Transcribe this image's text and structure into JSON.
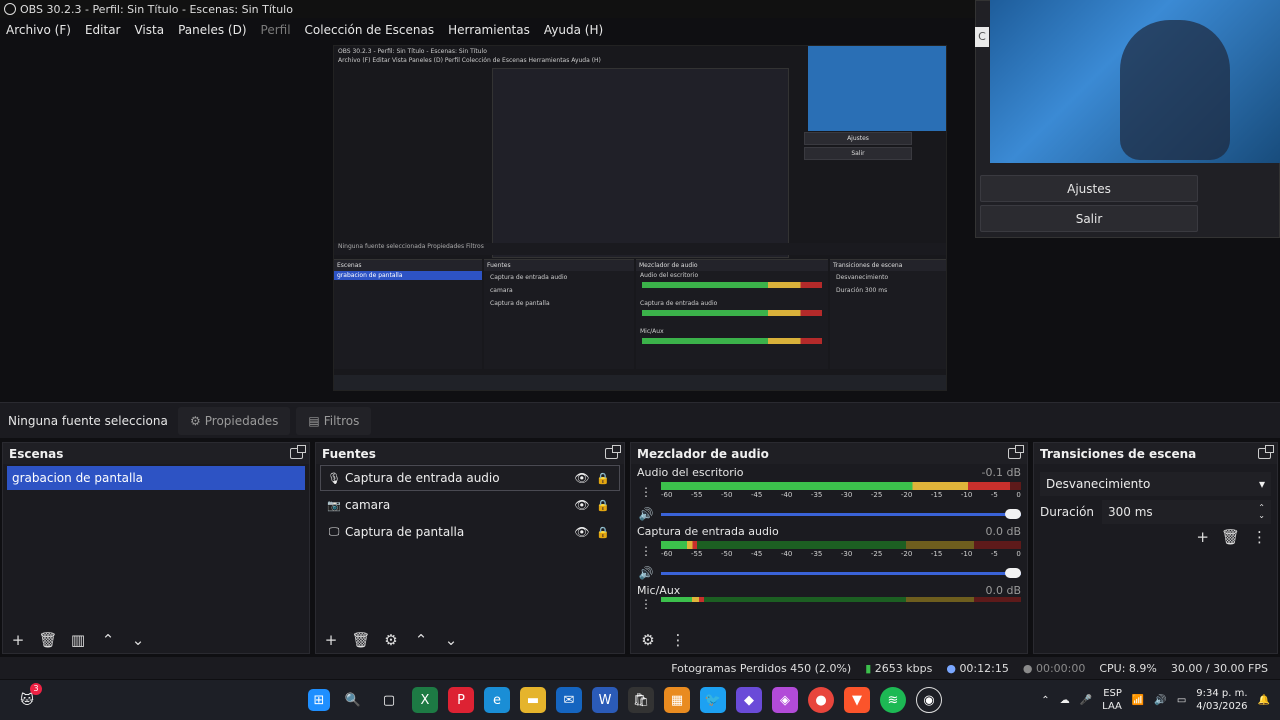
{
  "window": {
    "title": "OBS 30.2.3 - Perfil: Sin Título - Escenas: Sin Título"
  },
  "menu": [
    {
      "label": "Archivo (F)",
      "disabled": false
    },
    {
      "label": "Editar",
      "disabled": false
    },
    {
      "label": "Vista",
      "disabled": false
    },
    {
      "label": "Paneles (D)",
      "disabled": false
    },
    {
      "label": "Perfil",
      "disabled": true
    },
    {
      "label": "Colección de Escenas",
      "disabled": false
    },
    {
      "label": "Herramientas",
      "disabled": false
    },
    {
      "label": "Ayuda (H)",
      "disabled": false
    }
  ],
  "camera_window": {
    "c_label": "C",
    "buttons": [
      "Ajustes",
      "Salir"
    ]
  },
  "nested_preview": {
    "title": "OBS 30.2.3 - Perfil: Sin Título - Escenas: Sin Título",
    "menu": "Archivo (F)   Editar   Vista   Paneles (D)   Perfil   Colección de Escenas   Herramientas   Ayuda (H)",
    "strip": "Ninguna fuente seleccionada      Propiedades      Filtros",
    "scenes_head": "Escenas",
    "scene_sel": "grabacion de pantalla",
    "sources_head": "Fuentes",
    "sources": [
      "Captura de entrada audio",
      "camara",
      "Captura de pantalla"
    ],
    "mixer_head": "Mezclador de audio",
    "mixer_rows": [
      "Audio del escritorio",
      "Captura de entrada audio",
      "Mic/Aux"
    ],
    "trans_head": "Transiciones de escena",
    "trans_sel": "Desvanecimiento",
    "trans_dur": "Duración     300 ms",
    "buttons": [
      "Ajustes",
      "Salir"
    ]
  },
  "source_bar": {
    "no_source": "Ninguna fuente selecciona",
    "properties": "Propiedades",
    "filters": "Filtros"
  },
  "scenes": {
    "title": "Escenas",
    "items": [
      "grabacion de pantalla"
    ]
  },
  "sources": {
    "title": "Fuentes",
    "items": [
      {
        "name": "Captura de entrada audio",
        "icon": "mic-icon",
        "glyph": "🎙"
      },
      {
        "name": "camara",
        "icon": "camera-icon",
        "glyph": "📷"
      },
      {
        "name": "Captura de pantalla",
        "icon": "monitor-icon",
        "glyph": "🖵"
      }
    ]
  },
  "mixer": {
    "title": "Mezclador de audio",
    "scale": [
      "-60",
      "-55",
      "-50",
      "-45",
      "-40",
      "-35",
      "-30",
      "-25",
      "-20",
      "-15",
      "-10",
      "-5",
      "0"
    ],
    "channels": [
      {
        "name": "Audio del escritorio",
        "db": "-0.1 dB",
        "level": 0.97
      },
      {
        "name": "Captura de entrada audio",
        "db": "0.0 dB",
        "level": 0.1
      },
      {
        "name": "Mic/Aux",
        "db": "0.0 dB",
        "level": 0.12
      }
    ]
  },
  "transitions": {
    "title": "Transiciones de escena",
    "selected": "Desvanecimiento",
    "duration_label": "Duración",
    "duration_value": "300 ms"
  },
  "status": {
    "dropped": "Fotogramas Perdidos 450 (2.0%)",
    "kbps": "2653 kbps",
    "rec_time": "00:12:15",
    "stream_time": "00:00:00",
    "cpu": "CPU: 8.9%",
    "fps": "30.00 / 30.00 FPS"
  },
  "taskbar": {
    "lang": "ESP",
    "lang2": "LAA",
    "time": "9:34 p. m.",
    "date": "4/03/2026",
    "notif_badge": "3",
    "colors": {
      "accent": "#2d53c4",
      "start": "#1f8fff"
    }
  }
}
